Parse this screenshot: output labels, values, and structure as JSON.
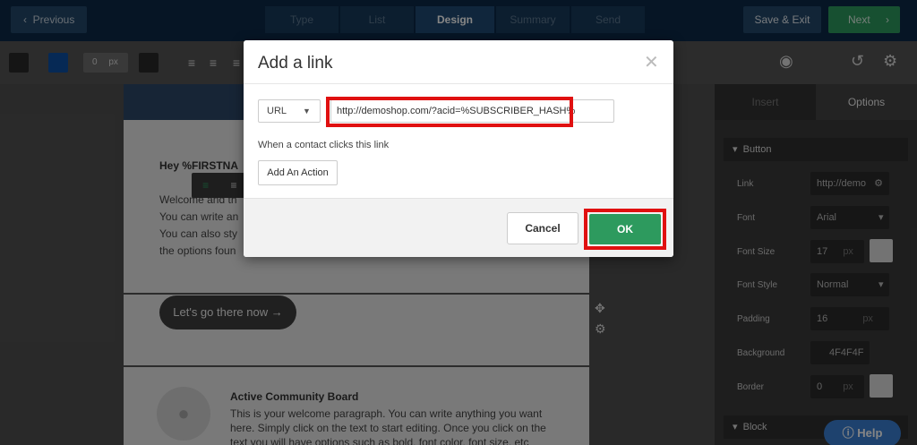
{
  "topbar": {
    "previous_label": "Previous",
    "previous_icon": "chevron-left-icon",
    "steps": [
      "Type",
      "List",
      "Design",
      "Summary",
      "Send"
    ],
    "save_exit_label": "Save & Exit",
    "next_label": "Next",
    "next_icon": "chevron-right-icon"
  },
  "toolbar": {
    "padding_value": "0",
    "padding_unit": "px",
    "colors": {
      "swatch_dark": "#2a2a2a",
      "swatch_blue": "#0d4fa3"
    },
    "icons": [
      "align-left-icon",
      "align-center-icon",
      "align-right-icon",
      "history-icon",
      "gear-icon"
    ]
  },
  "email": {
    "greeting": "Hey %FIRSTNA",
    "para_lines": [
      "Welcome and th",
      "You can write an",
      "You can also sty",
      "the options foun"
    ],
    "cta_label": "Let's go there now →",
    "community_title": "Active Community Board",
    "community_text": "This is your welcome paragraph. You can write anything you want here. Simply click on the text to start editing. Once you click on the text you will have options such as bold, font color, font size, etc"
  },
  "panel": {
    "tabs": [
      "Insert",
      "Options"
    ],
    "button_section": "Button",
    "block_section": "Block",
    "rows": [
      {
        "label": "Link",
        "value": "http://demo"
      },
      {
        "label": "Font",
        "value": "Arial"
      },
      {
        "label": "Font Size",
        "value": "17",
        "unit": "px"
      },
      {
        "label": "Font Style",
        "value": "Normal"
      },
      {
        "label": "Padding",
        "value": "16",
        "unit": "px"
      },
      {
        "label": "Background",
        "value": "4F4F4F"
      },
      {
        "label": "Border",
        "value": "0",
        "unit": "px"
      }
    ]
  },
  "help_label": "Help",
  "modal": {
    "title": "Add a link",
    "link_type": "URL",
    "url_value": "http://demoshop.com/?acid=%SUBSCRIBER_HASH%",
    "hint": "When a contact clicks this link",
    "add_action_label": "Add An Action",
    "cancel_label": "Cancel",
    "ok_label": "OK",
    "highlight_color": "#e01010",
    "ok_color": "#2d9a5e"
  }
}
